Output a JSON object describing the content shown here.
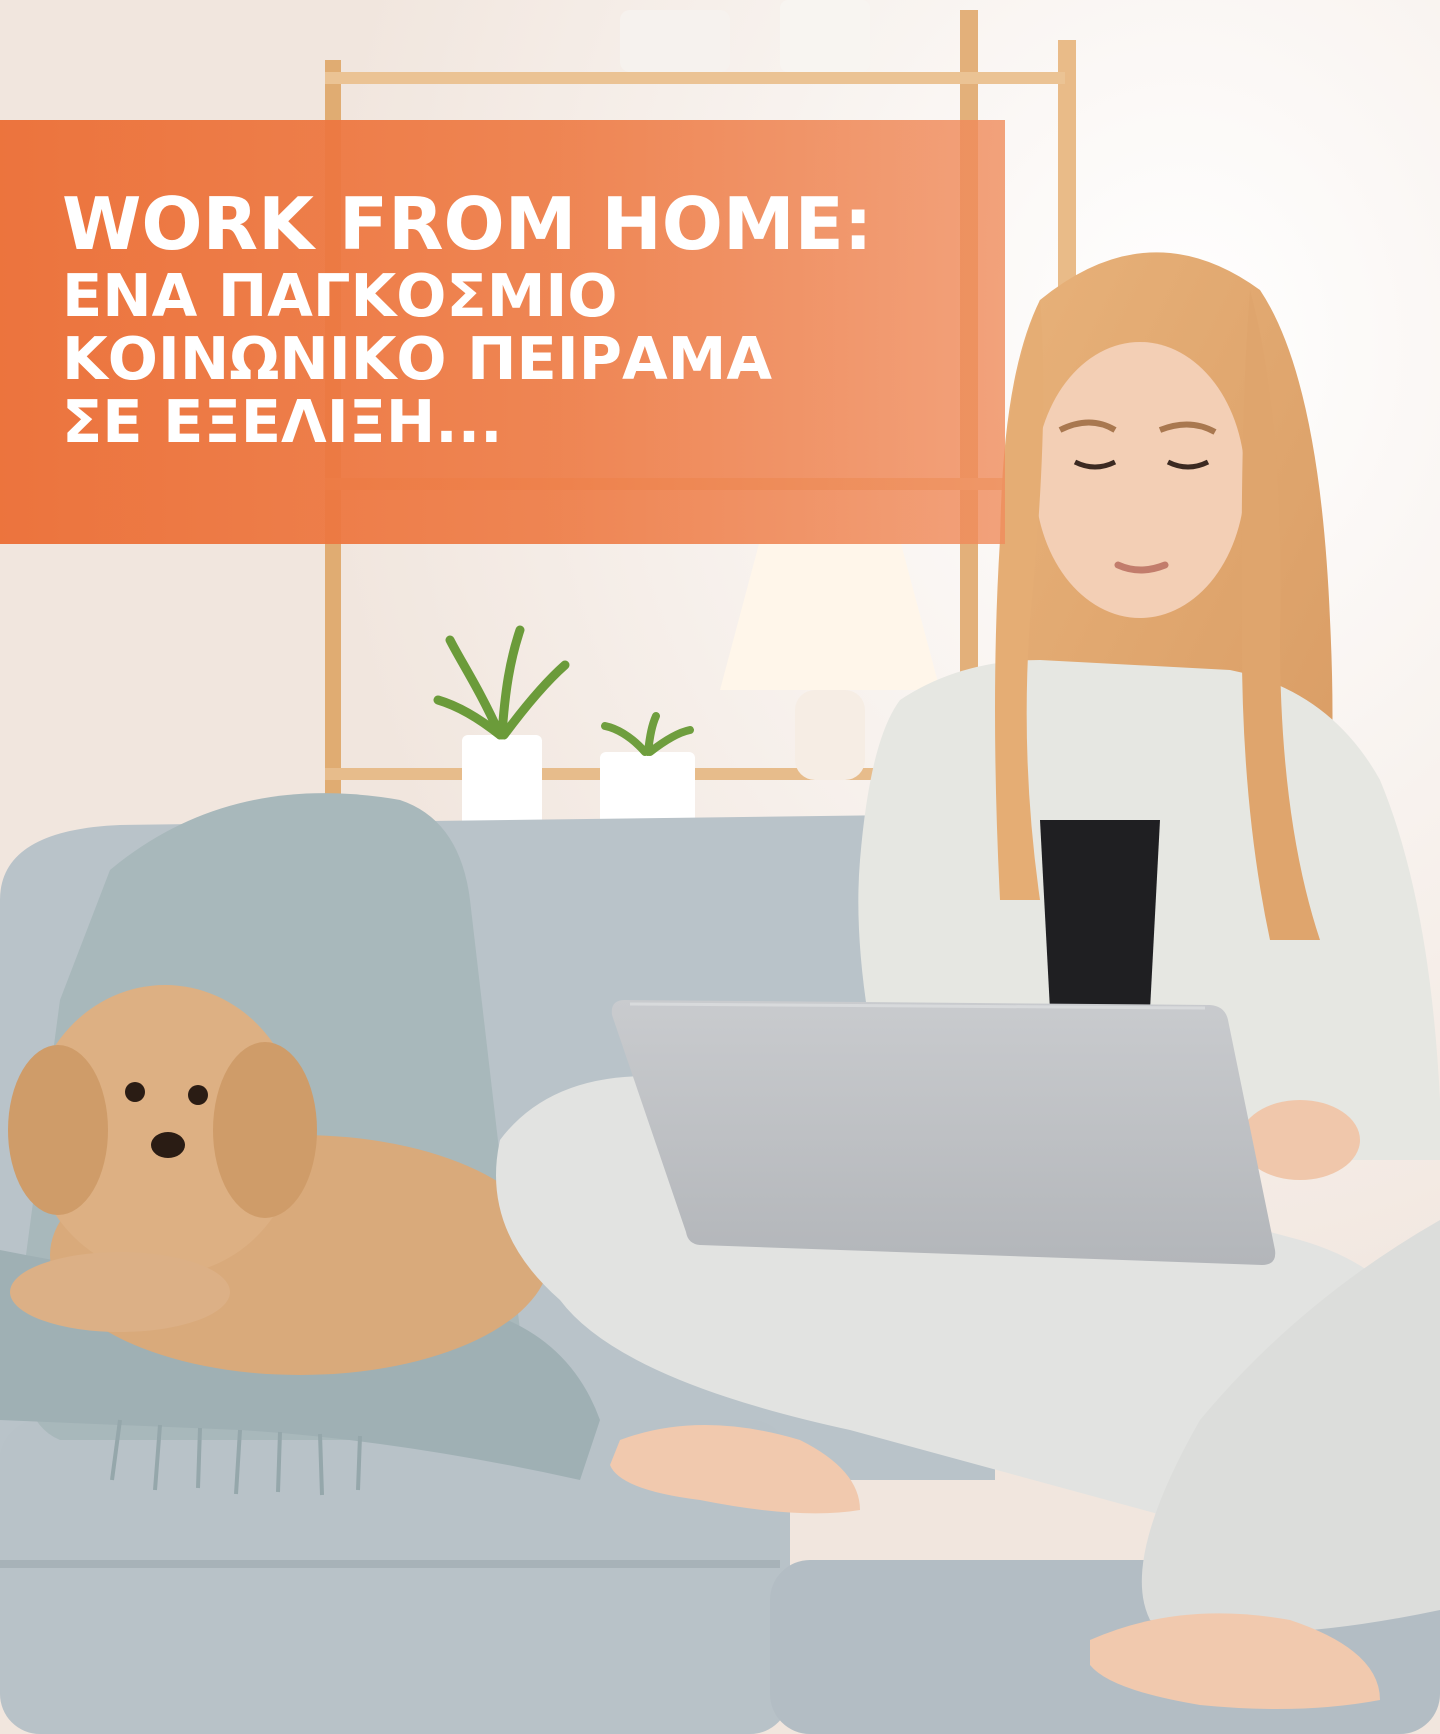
{
  "headline": {
    "line1": "WORK FROM HOME:",
    "line2": "ΕΝΑ ΠΑΓΚΟΣΜΙΟ",
    "line3": "ΚΟΙΝΩΝΙΚΟ ΠΕΙΡΑΜΑ",
    "line4": "ΣΕ ΕΞΕΛΙΞΗ..."
  },
  "colors": {
    "banner": "#ec7038",
    "headline_text": "#ffffff",
    "sofa": "#b9c3c9",
    "throw_blanket": "#a9b9bc",
    "dog": "#d8a878",
    "laptop": "#bdbfc2",
    "wall": "#f4ece6"
  },
  "scene_elements": [
    "shelf",
    "plant",
    "lamp",
    "sofa",
    "throw-blanket",
    "dog",
    "woman",
    "laptop"
  ]
}
